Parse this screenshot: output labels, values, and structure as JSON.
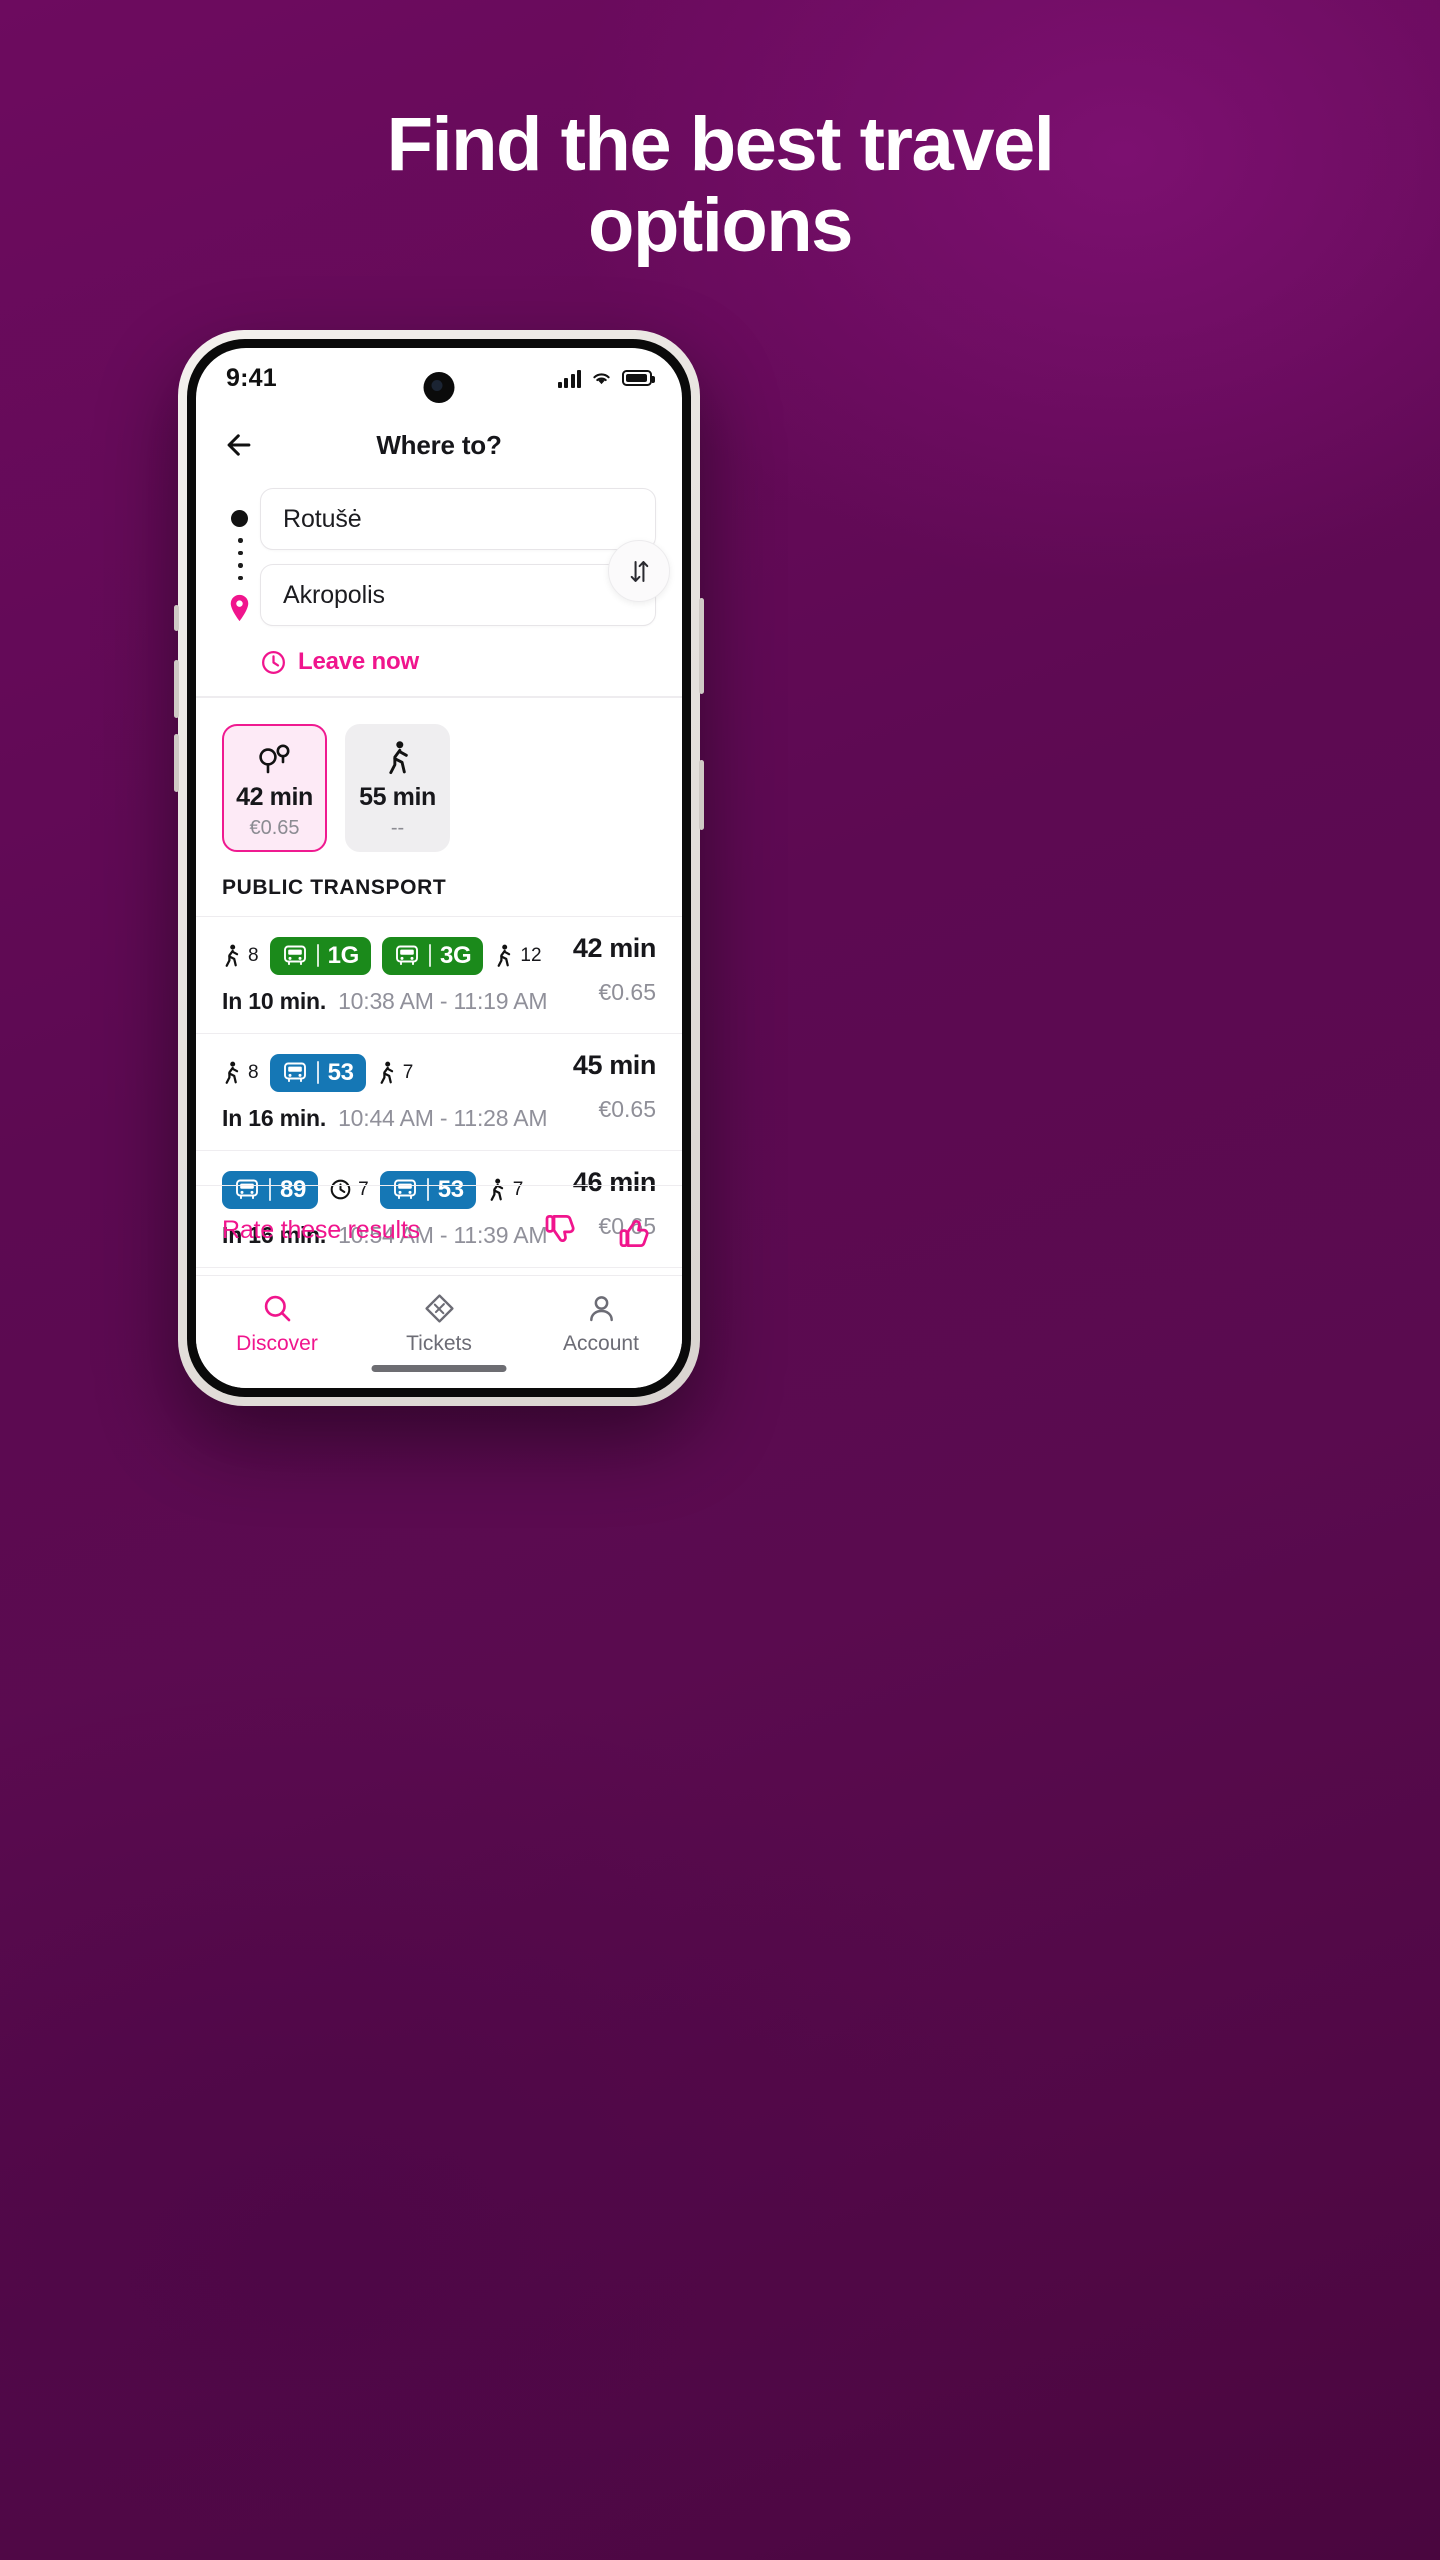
{
  "promo": {
    "headline_line1": "Find the best travel",
    "headline_line2": "options"
  },
  "status_bar": {
    "time": "9:41",
    "signal_icon": "cellular-signal-icon",
    "wifi_icon": "wifi-icon",
    "battery_icon": "battery-icon"
  },
  "header": {
    "back_icon": "back-arrow-icon",
    "title": "Where to?"
  },
  "search": {
    "origin": {
      "value": "Rotušė",
      "marker_icon": "origin-dot-icon"
    },
    "destination": {
      "value": "Akropolis",
      "marker_icon": "destination-pin-icon"
    },
    "swap_icon": "swap-vertical-icon",
    "leave_now": {
      "label": "Leave now",
      "icon": "clock-icon"
    }
  },
  "modes": [
    {
      "icon": "transit-stops-icon",
      "time": "42 min",
      "price": "€0.65",
      "selected": true
    },
    {
      "icon": "walking-icon",
      "time": "55 min",
      "price": "--",
      "selected": false
    }
  ],
  "section_title": "PUBLIC TRANSPORT",
  "routes": [
    {
      "segments": [
        {
          "type": "walk",
          "icon": "walking-icon",
          "value": "8"
        },
        {
          "type": "bus",
          "icon": "bus-icon",
          "line": "1G",
          "color": "#1b8a1b"
        },
        {
          "type": "bus",
          "icon": "bus-icon",
          "line": "3G",
          "color": "#1b8a1b"
        },
        {
          "type": "walk",
          "icon": "walking-icon",
          "value": "12"
        }
      ],
      "departs_in": "In 10 min.",
      "time_range": "10:38 AM - 11:19 AM",
      "duration": "42 min",
      "price": "€0.65"
    },
    {
      "segments": [
        {
          "type": "walk",
          "icon": "walking-icon",
          "value": "8"
        },
        {
          "type": "bus",
          "icon": "bus-icon",
          "line": "53",
          "color": "#1577b5"
        },
        {
          "type": "walk",
          "icon": "walking-icon",
          "value": "7"
        }
      ],
      "departs_in": "In 16 min.",
      "time_range": "10:44 AM - 11:28 AM",
      "duration": "45 min",
      "price": "€0.65"
    },
    {
      "segments": [
        {
          "type": "bus",
          "icon": "bus-icon",
          "line": "89",
          "color": "#1577b5"
        },
        {
          "type": "wait",
          "icon": "clock-icon",
          "value": "7"
        },
        {
          "type": "bus",
          "icon": "bus-icon",
          "line": "53",
          "color": "#1577b5"
        },
        {
          "type": "walk",
          "icon": "walking-icon",
          "value": "7"
        }
      ],
      "departs_in": "In 16 min.",
      "time_range": "10:54 AM - 11:39 AM",
      "duration": "46 min",
      "price": "€0.65"
    }
  ],
  "rate": {
    "label": "Rate these results",
    "thumbs_down_icon": "thumbs-down-icon",
    "thumbs_up_icon": "thumbs-up-icon"
  },
  "bottom_nav": [
    {
      "label": "Discover",
      "icon": "search-icon",
      "active": true
    },
    {
      "label": "Tickets",
      "icon": "ticket-icon",
      "active": false
    },
    {
      "label": "Account",
      "icon": "person-icon",
      "active": false
    }
  ],
  "colors": {
    "brand_pink": "#f0158d",
    "bg_purple": "#5e0b52",
    "bus_green": "#1b8a1b",
    "bus_blue": "#1577b5"
  }
}
